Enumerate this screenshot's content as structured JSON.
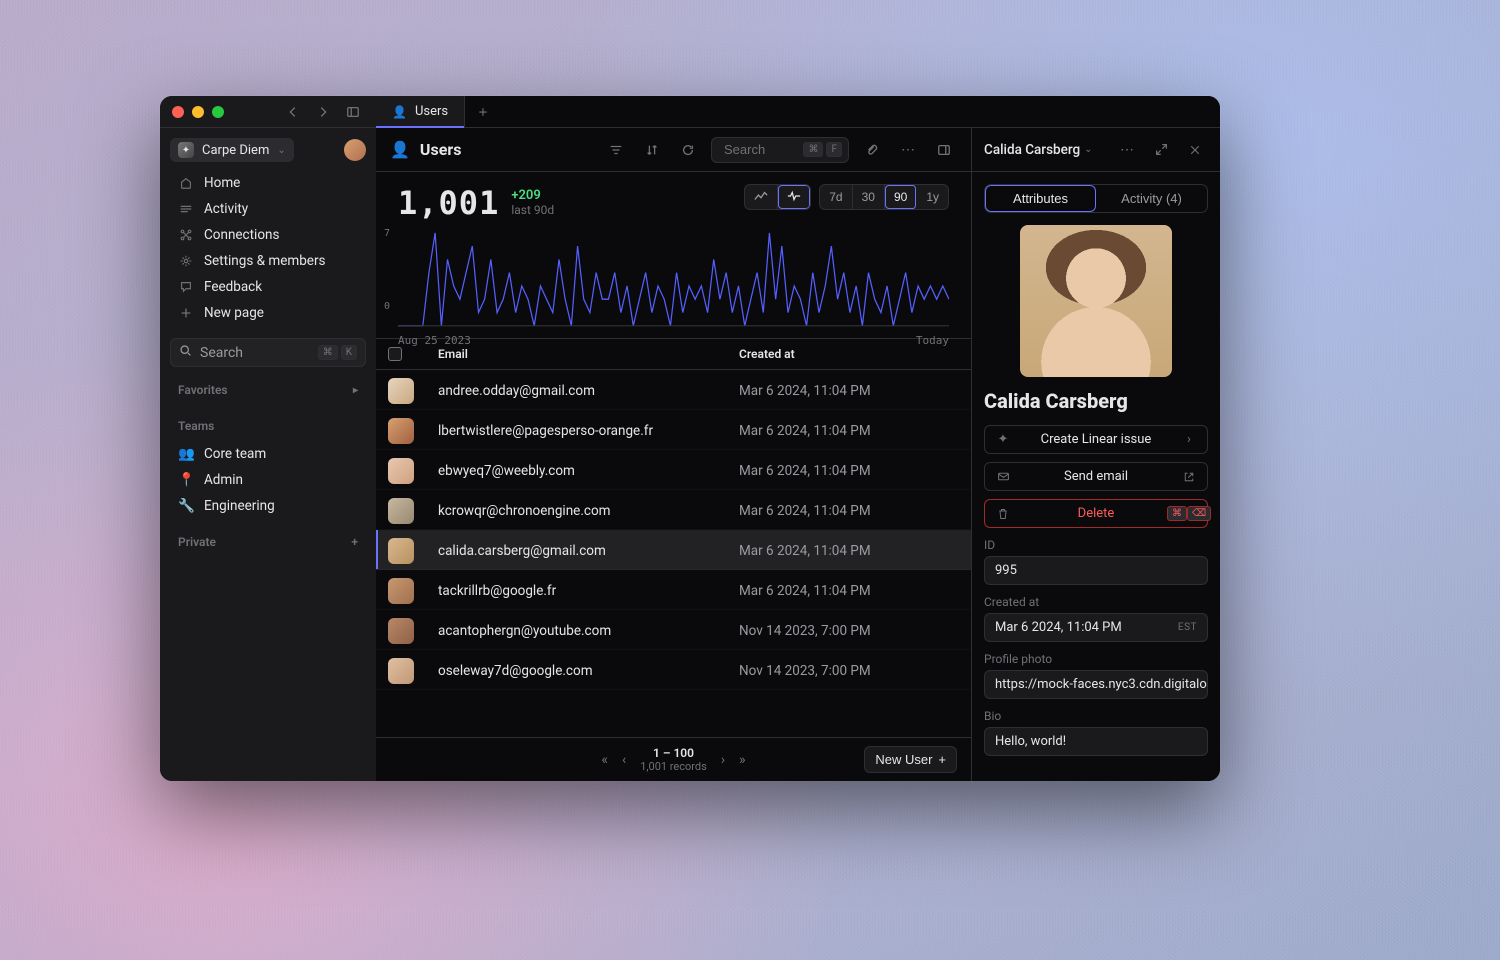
{
  "workspace": {
    "name": "Carpe Diem"
  },
  "sidebar": {
    "nav": [
      {
        "label": "Home",
        "icon": "home-icon"
      },
      {
        "label": "Activity",
        "icon": "activity-icon"
      },
      {
        "label": "Connections",
        "icon": "connections-icon"
      },
      {
        "label": "Settings & members",
        "icon": "settings-icon"
      },
      {
        "label": "Feedback",
        "icon": "feedback-icon"
      },
      {
        "label": "New page",
        "icon": "plus-icon"
      }
    ],
    "search_placeholder": "Search",
    "search_shortcut": [
      "⌘",
      "K"
    ],
    "sections": {
      "favorites": "Favorites",
      "teams": "Teams",
      "private": "Private"
    },
    "teams": [
      {
        "icon": "👥",
        "label": "Core team"
      },
      {
        "icon": "📍",
        "label": "Admin"
      },
      {
        "icon": "🔧",
        "label": "Engineering"
      }
    ]
  },
  "tab": {
    "icon": "👤",
    "label": "Users"
  },
  "page": {
    "icon": "👤",
    "title": "Users",
    "search_placeholder": "Search",
    "search_shortcut": [
      "⌘",
      "F"
    ]
  },
  "stats": {
    "total": "1,001",
    "delta": "+209",
    "delta_sub": "last 90d"
  },
  "chart_ranges": [
    "7d",
    "30",
    "90",
    "1y"
  ],
  "chart_range_active": "90",
  "chart": {
    "y_max": "7",
    "y_min": "0",
    "x_start": "Aug 25 2023",
    "x_end": "Today"
  },
  "table": {
    "columns": {
      "email": "Email",
      "created": "Created at"
    },
    "rows": [
      {
        "email": "andree.odday@gmail.com",
        "created": "Mar 6 2024, 11:04 PM"
      },
      {
        "email": "lbertwistlere@pagesperso-orange.fr",
        "created": "Mar 6 2024, 11:04 PM"
      },
      {
        "email": "ebwyeq7@weebly.com",
        "created": "Mar 6 2024, 11:04 PM"
      },
      {
        "email": "kcrowqr@chronoengine.com",
        "created": "Mar 6 2024, 11:04 PM"
      },
      {
        "email": "calida.carsberg@gmail.com",
        "created": "Mar 6 2024, 11:04 PM",
        "selected": true
      },
      {
        "email": "tackrillrb@google.fr",
        "created": "Mar 6 2024, 11:04 PM"
      },
      {
        "email": "acantophergn@youtube.com",
        "created": "Nov 14 2023, 7:00 PM"
      },
      {
        "email": "oseleway7d@google.com",
        "created": "Nov 14 2023, 7:00 PM"
      }
    ],
    "pager": {
      "range": "1 – 100",
      "total": "1,001 records"
    },
    "new_button": "New User"
  },
  "detail": {
    "title": "Calida Carsberg",
    "tabs": {
      "attributes": "Attributes",
      "activity": "Activity (4)"
    },
    "name": "Calida Carsberg",
    "actions": {
      "linear": "Create Linear issue",
      "email": "Send email",
      "delete": "Delete",
      "delete_shortcut": [
        "⌘",
        "⌫"
      ]
    },
    "fields": {
      "id_label": "ID",
      "id_value": "995",
      "created_label": "Created at",
      "created_value": "Mar 6 2024, 11:04 PM",
      "created_tz": "EST",
      "photo_label": "Profile photo",
      "photo_value": "https://mock-faces.nyc3.cdn.digitalo",
      "bio_label": "Bio",
      "bio_value": "Hello, world!"
    }
  },
  "chart_data": {
    "type": "line",
    "title": "",
    "xlabel": "",
    "ylabel": "",
    "ylim": [
      0,
      7
    ],
    "x_range": [
      "Aug 25 2023",
      "Today"
    ],
    "x": [
      0,
      1,
      2,
      3,
      4,
      5,
      6,
      7,
      8,
      9,
      10,
      11,
      12,
      13,
      14,
      15,
      16,
      17,
      18,
      19,
      20,
      21,
      22,
      23,
      24,
      25,
      26,
      27,
      28,
      29,
      30,
      31,
      32,
      33,
      34,
      35,
      36,
      37,
      38,
      39,
      40,
      41,
      42,
      43,
      44,
      45,
      46,
      47,
      48,
      49,
      50,
      51,
      52,
      53,
      54,
      55,
      56,
      57,
      58,
      59,
      60,
      61,
      62,
      63,
      64,
      65,
      66,
      67,
      68,
      69,
      70,
      71,
      72,
      73,
      74,
      75,
      76,
      77,
      78,
      79,
      80,
      81,
      82,
      83,
      84,
      85,
      86,
      87,
      88,
      89
    ],
    "values": [
      0,
      0,
      0,
      0,
      0,
      4,
      7,
      0,
      5,
      3,
      2,
      4,
      6,
      1,
      2,
      5,
      1,
      2,
      4,
      1,
      3,
      2,
      0,
      3,
      2,
      1,
      5,
      2,
      0,
      6,
      2,
      1,
      4,
      2,
      2,
      4,
      1,
      3,
      0,
      2,
      4,
      1,
      3,
      2,
      0,
      4,
      1,
      3,
      2,
      3,
      1,
      5,
      2,
      4,
      1,
      3,
      0,
      2,
      4,
      1,
      7,
      2,
      6,
      1,
      3,
      2,
      0,
      4,
      1,
      3,
      6,
      2,
      4,
      1,
      3,
      0,
      4,
      2,
      1,
      3,
      0,
      2,
      4,
      1,
      3,
      2,
      3,
      2,
      3,
      2
    ]
  }
}
